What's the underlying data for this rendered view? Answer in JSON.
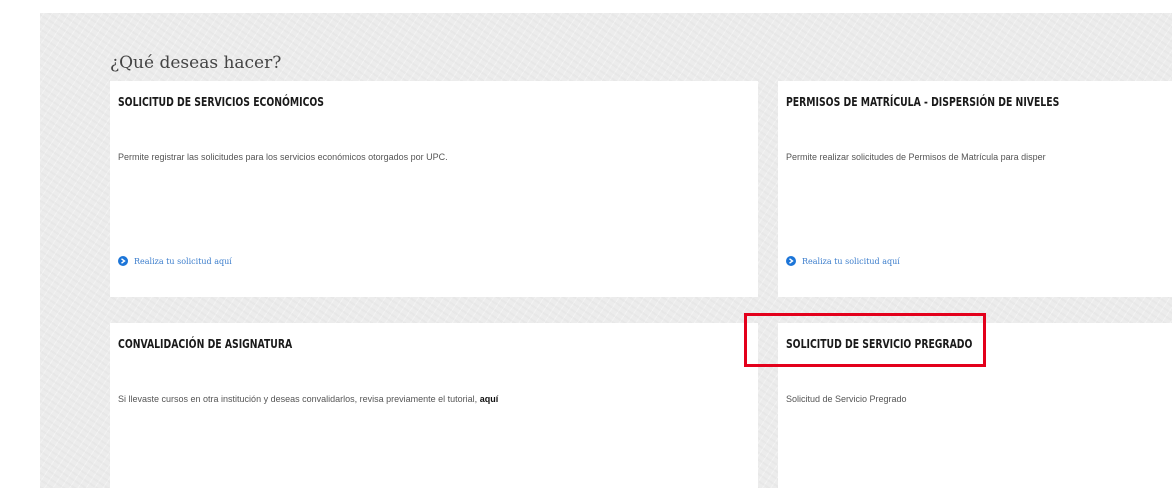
{
  "heading": "¿Qué deseas hacer?",
  "cards": [
    {
      "title": "SOLICITUD DE SERVICIOS ECONÓMICOS",
      "description": "Permite registrar las solicitudes para los servicios económicos otorgados por UPC.",
      "link_label": "Realiza tu solicitud aquí"
    },
    {
      "title": "PERMISOS DE MATRÍCULA - DISPERSIÓN DE NIVELES",
      "description": "Permite realizar solicitudes de Permisos de Matrícula para disper",
      "link_label": "Realiza tu solicitud aquí"
    },
    {
      "title": "CONVALIDACIÓN DE ASIGNATURA",
      "description": "Si llevaste cursos en otra institución y deseas convalidarlos, revisa previamente el tutorial,",
      "description_link": "aquí"
    },
    {
      "title": "SOLICITUD DE SERVICIO PREGRADO",
      "description": "Solicitud de Servicio Pregrado"
    }
  ],
  "colors": {
    "highlight": "#e3001b",
    "link": "#3b7dcc",
    "icon": "#1c75d8"
  }
}
